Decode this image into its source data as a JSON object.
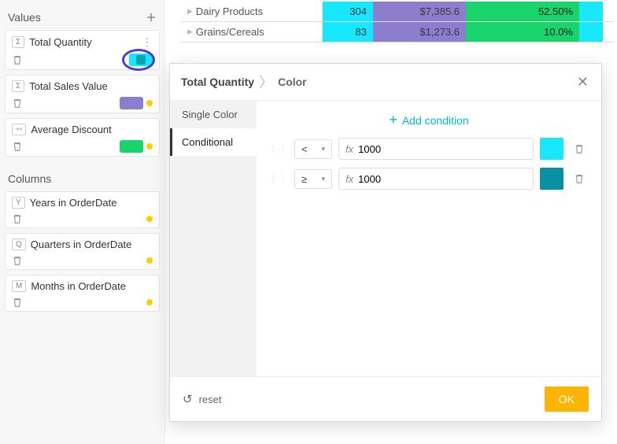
{
  "sidebar": {
    "values_header": "Values",
    "columns_header": "Columns",
    "values": [
      {
        "letter": "Σ",
        "name": "Total Quantity",
        "chip_bg": "#17e7ff",
        "chip_inner": "#0aa3b5"
      },
      {
        "letter": "Σ",
        "name": "Total Sales Value",
        "chip_bg": "#8c7dce",
        "chip_inner": "#8c7dce"
      },
      {
        "letter": "⇿",
        "name": "Average Discount",
        "chip_bg": "#19d36b",
        "chip_inner": "#19d36b"
      }
    ],
    "columns": [
      {
        "letter": "Y",
        "name": "Years in OrderDate"
      },
      {
        "letter": "Q",
        "name": "Quarters in OrderDate"
      },
      {
        "letter": "M",
        "name": "Months in OrderDate"
      }
    ]
  },
  "table": {
    "rows": [
      {
        "label": "Dairy Products",
        "qty": "304",
        "qty_bg": "#17e7ff",
        "sales": "$7,385.6",
        "sales_bg": "#8c7dce",
        "disc": "52.50%",
        "disc_bg": "#19d36b",
        "pad_bg": "#17e7ff"
      },
      {
        "label": "Grains/Cereals",
        "qty": "83",
        "qty_bg": "#17e7ff",
        "sales": "$1,273.6",
        "sales_bg": "#8c7dce",
        "disc": "10.0%",
        "disc_bg": "#19d36b",
        "pad_bg": "#17e7ff"
      }
    ]
  },
  "popover": {
    "crumb1": "Total Quantity",
    "crumb2": "Color",
    "tabs": {
      "single": "Single Color",
      "conditional": "Conditional"
    },
    "add_label": "Add condition",
    "fx": "fx",
    "conditions": [
      {
        "op": "<",
        "value": "1000",
        "color": "#17e7ff"
      },
      {
        "op": "≥",
        "value": "1000",
        "color": "#0a90a3"
      }
    ],
    "reset": "reset",
    "ok": "OK"
  }
}
